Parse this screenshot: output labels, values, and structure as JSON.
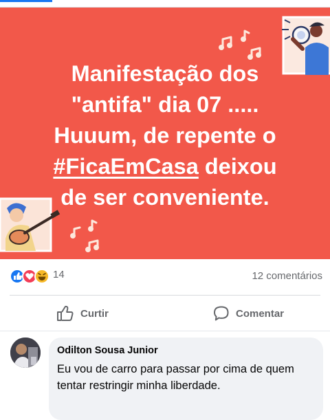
{
  "post": {
    "lines": [
      "Manifestação dos",
      "\"antifa\" dia 07 .....",
      "Huuum, de repente o",
      "deixou",
      "de ser conveniente."
    ],
    "hashtag": "#FicaEmCasa",
    "background_color": "#f2584a"
  },
  "reactions": {
    "icons": [
      "like-icon",
      "love-icon",
      "haha-icon"
    ],
    "count": "14",
    "comments_label": "12 comentários"
  },
  "actions": {
    "like_label": "Curtir",
    "comment_label": "Comentar"
  },
  "comment": {
    "author": "Odilton Sousa Junior",
    "text": "Eu vou de carro para passar por cima de quem tentar restringir minha liberdade."
  },
  "colors": {
    "accent": "#1877f2",
    "muted_text": "#65676b",
    "bubble": "#f0f2f5"
  }
}
